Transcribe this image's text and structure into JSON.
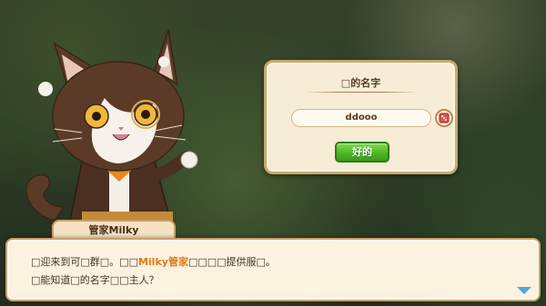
{
  "name_dialog": {
    "title": "□的名字",
    "name_value": "ddooo",
    "ok_label": "好的"
  },
  "dialogue": {
    "speaker": "管家Milky",
    "line1_a": "□迎来到可□群□。□□",
    "line1_hl": "Milky管家",
    "line1_b": "□□□□提供服□。",
    "line2": "□能知道□的名字□□主人？"
  },
  "icons": {
    "random_name": "dice-icon",
    "advance": "down-arrow-icon"
  },
  "colors": {
    "ok_button": "#4fb826",
    "highlight_text": "#e07a18",
    "advance_arrow": "#4aa8e0"
  }
}
